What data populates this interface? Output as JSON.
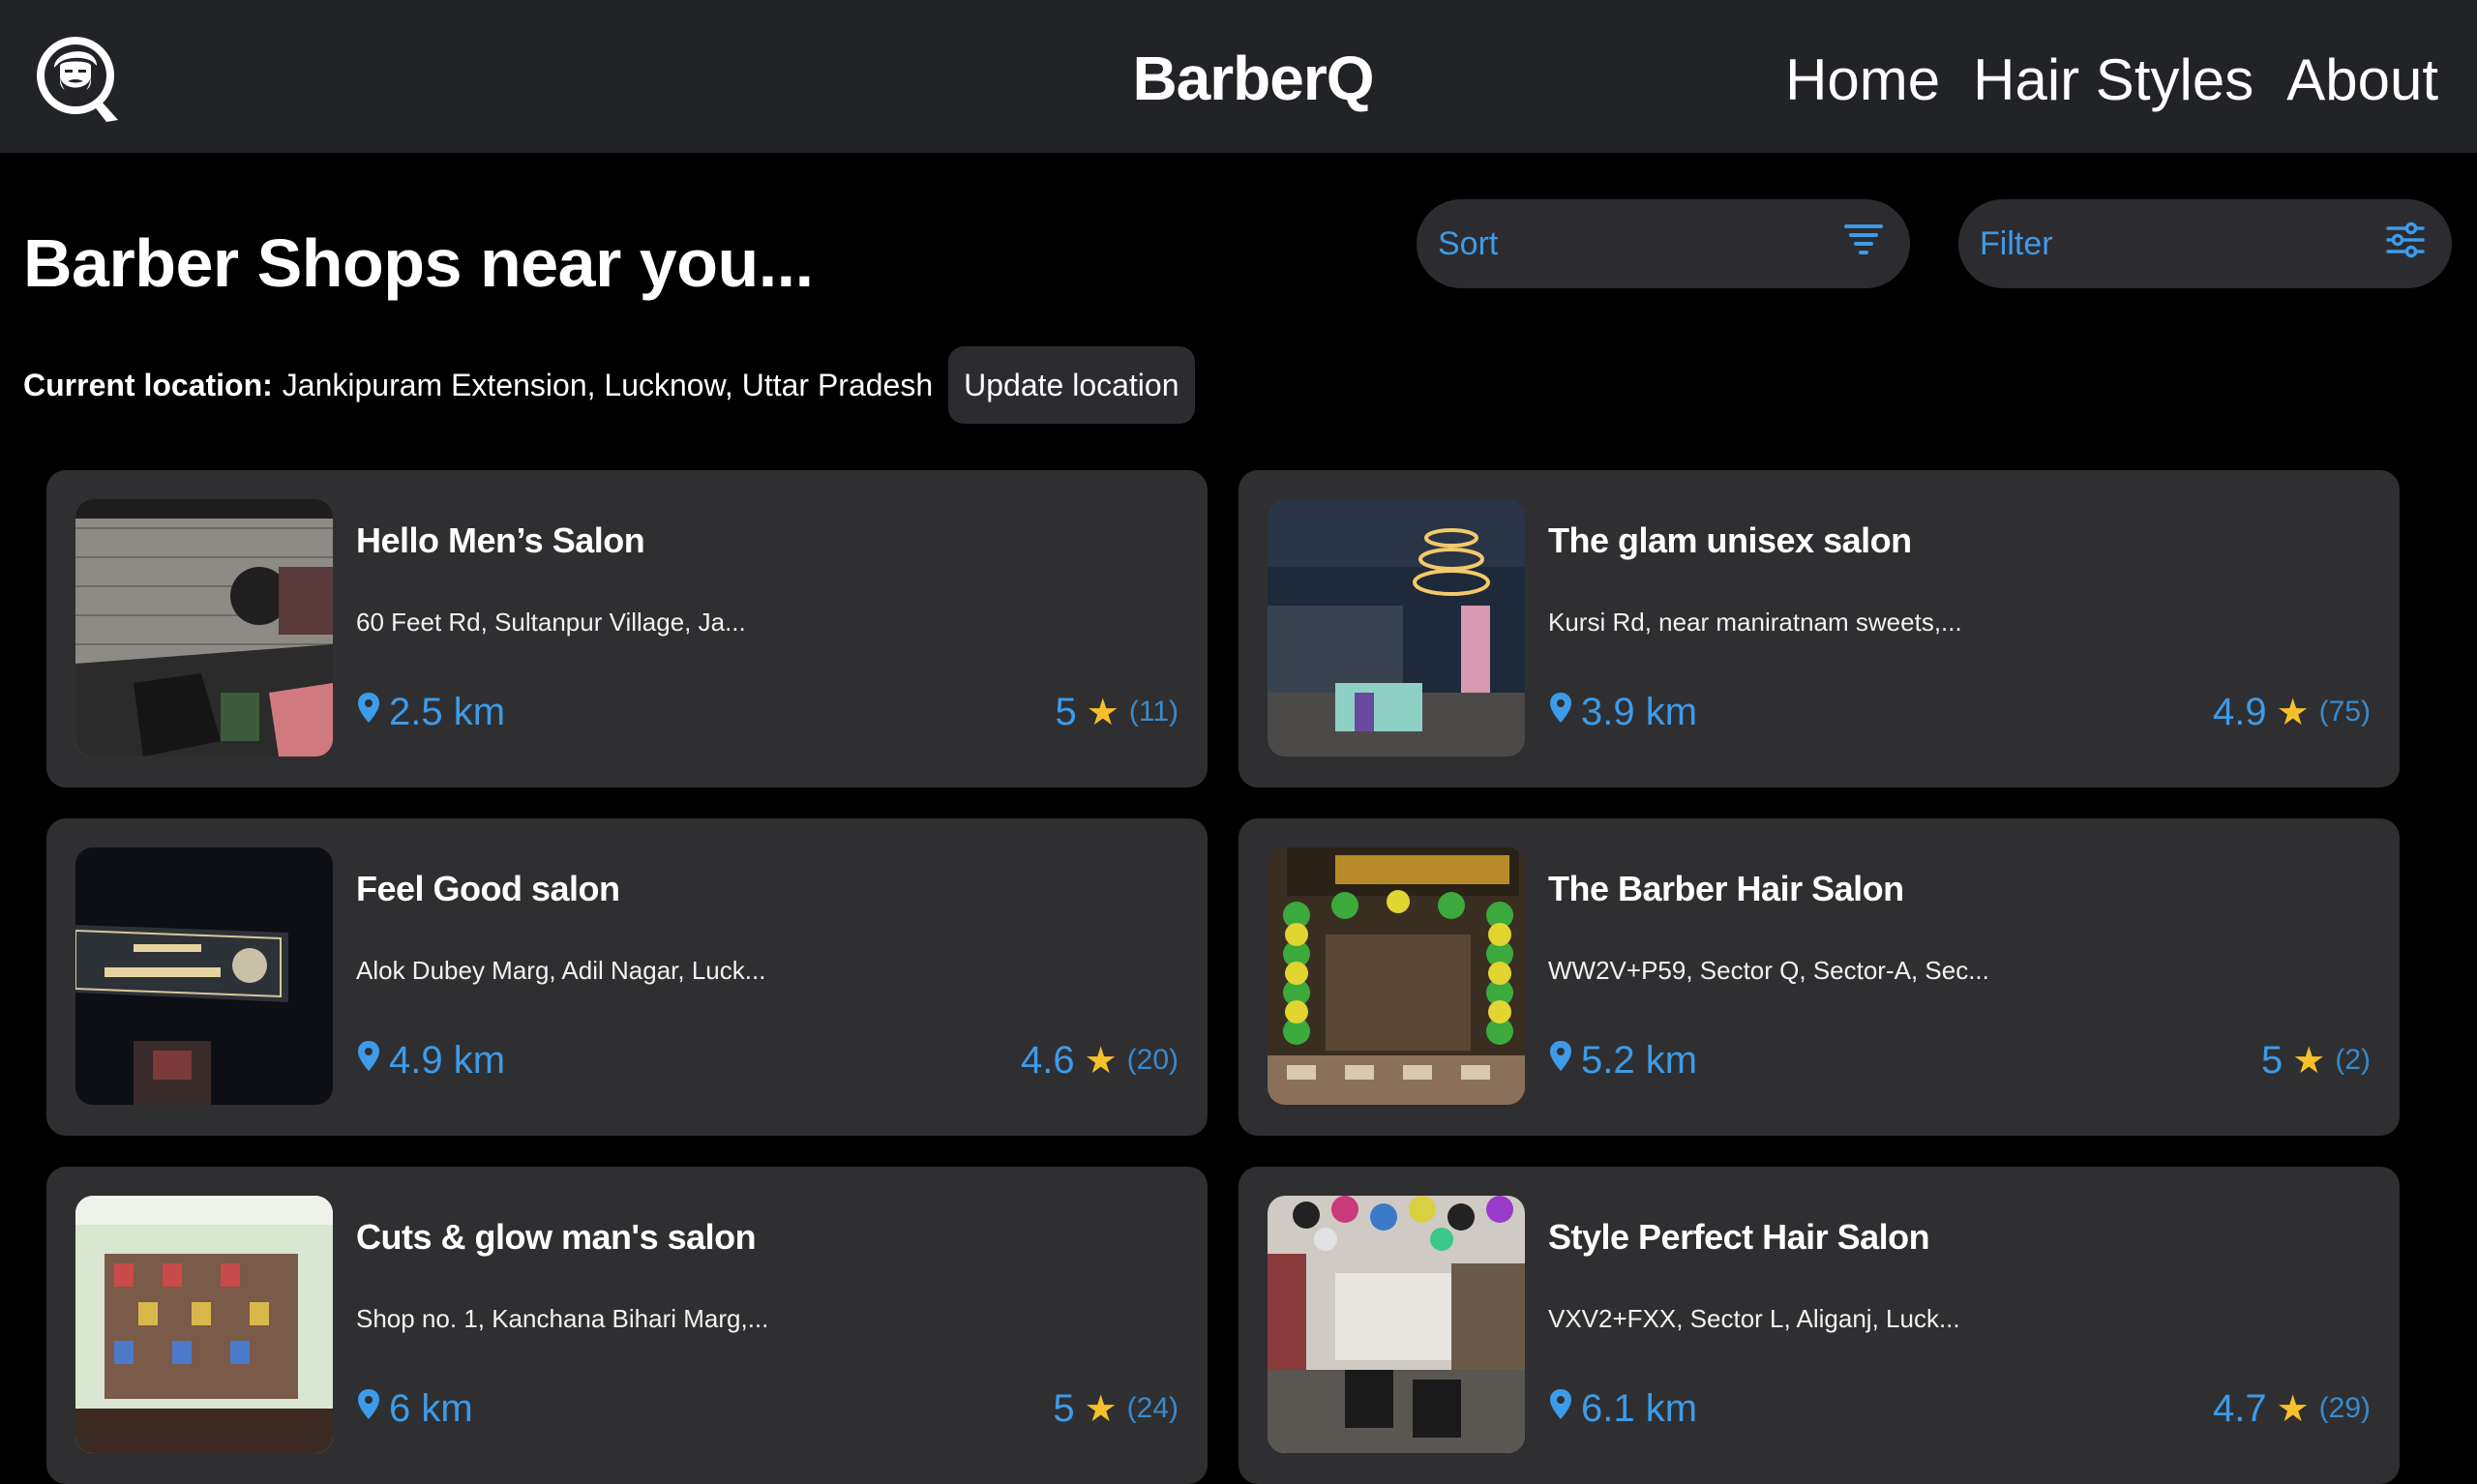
{
  "header": {
    "brand": "BarberQ",
    "nav": [
      "Home",
      "Hair Styles",
      "About"
    ]
  },
  "page": {
    "title": "Barber Shops near you...",
    "sort_label": "Sort",
    "filter_label": "Filter",
    "location_label": "Current location:",
    "location_value": "Jankipuram Extension, Lucknow, Uttar Pradesh",
    "update_label": "Update location"
  },
  "shops": [
    {
      "name": "Hello Men’s Salon",
      "address": "60 Feet Rd, Sultanpur Village, Ja...",
      "distance": "2.5 km",
      "rating": "5",
      "reviews": "(11)"
    },
    {
      "name": "The glam unisex salon",
      "address": "Kursi Rd, near maniratnam sweets,...",
      "distance": "3.9 km",
      "rating": "4.9",
      "reviews": "(75)"
    },
    {
      "name": "Feel Good salon",
      "address": "Alok Dubey Marg, Adil Nagar, Luck...",
      "distance": "4.9 km",
      "rating": "4.6",
      "reviews": "(20)"
    },
    {
      "name": "The Barber Hair Salon",
      "address": "WW2V+P59, Sector Q, Sector-A, Sec...",
      "distance": "5.2 km",
      "rating": "5",
      "reviews": "(2)"
    },
    {
      "name": "Cuts & glow man's salon",
      "address": "Shop no. 1, Kanchana Bihari Marg,...",
      "distance": "6 km",
      "rating": "5",
      "reviews": "(24)"
    },
    {
      "name": "Style Perfect Hair Salon",
      "address": "VXV2+FXX, Sector L, Aliganj, Luck...",
      "distance": "6.1 km",
      "rating": "4.7",
      "reviews": "(29)"
    }
  ],
  "colors": {
    "accent": "#3d9be9",
    "star": "#f6c02b",
    "card": "#2f2f31",
    "header": "#222326"
  }
}
